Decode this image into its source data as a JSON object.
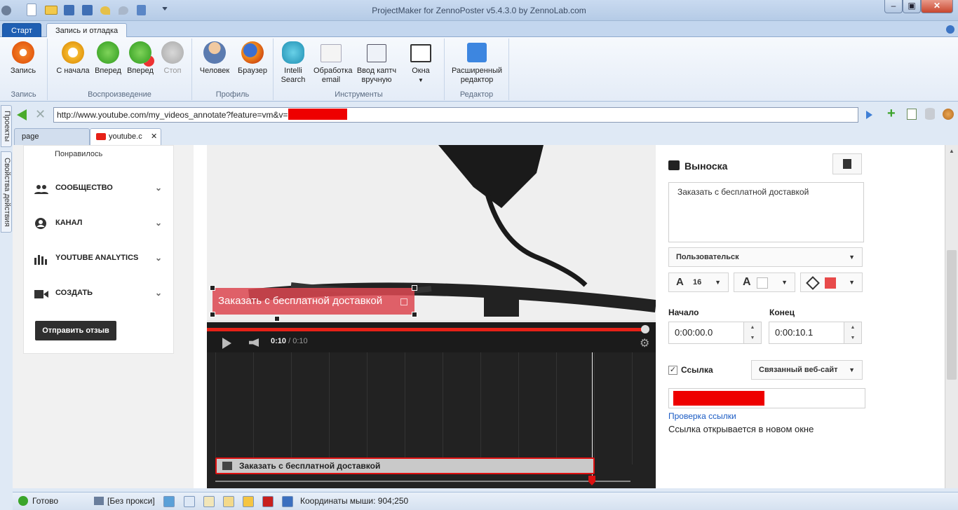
{
  "window": {
    "title": "ProjectMaker for ZennoPoster v5.4.3.0 by ZennoLab.com"
  },
  "ribbon_tabs": {
    "start": "Старт",
    "record_debug": "Запись и отладка"
  },
  "ribbon": {
    "groups": {
      "record": "Запись",
      "playback": "Воспроизведение",
      "profile": "Профиль",
      "tools": "Инструменты",
      "editor": "Редактор"
    },
    "buttons": {
      "record": "Запись",
      "from_start": "С начала",
      "forward": "Вперед",
      "forward2": "Вперед",
      "stop": "Стоп",
      "human": "Человек",
      "browser": "Браузер",
      "intelli_search": "Intelli Search",
      "email_processing": "Обработка email",
      "captcha_manual": "Ввод каптч вручную",
      "windows": "Окна",
      "advanced_editor": "Расширенный редактор"
    }
  },
  "address": {
    "url": "http://www.youtube.com/my_videos_annotate?feature=vm&v="
  },
  "side_tabs": {
    "projects": "Проекты",
    "action_props": "Свойства действия"
  },
  "doc_tabs": {
    "page": "page",
    "youtube": "youtube.c"
  },
  "yt_sidebar": {
    "liked": "Понравилось",
    "items": [
      {
        "label": "СООБЩЕСТВО"
      },
      {
        "label": "КАНАЛ"
      },
      {
        "label": "YOUTUBE ANALYTICS"
      },
      {
        "label": "СОЗДАТЬ"
      }
    ],
    "feedback_button": "Отправить отзыв"
  },
  "video": {
    "annotation_text": "Заказать с бесплатной доставкой",
    "time_current": "0:10",
    "time_total": "/ 0:10",
    "progress": 1.0
  },
  "timeline": {
    "bar_text": "Заказать с бесплатной доставкой"
  },
  "editor_panel": {
    "heading": "Выноска",
    "text_value": "Заказать с бесплатной доставкой",
    "style_select": "Пользовательск",
    "font_size": "16",
    "text_color": "#ffffff",
    "bg_color": "#e84a4a",
    "start_label": "Начало",
    "end_label": "Конец",
    "start_value": "0:00:00.0",
    "end_value": "0:00:10.1",
    "link_label": "Ссылка",
    "link_type": "Связанный веб-сайт",
    "check_link": "Проверка ссылки",
    "opens_new": "Ссылка открывается в новом окне"
  },
  "status": {
    "ready": "Готово",
    "proxy": "[Без прокси]",
    "mouse_coords": "Координаты мыши: 904;250"
  }
}
